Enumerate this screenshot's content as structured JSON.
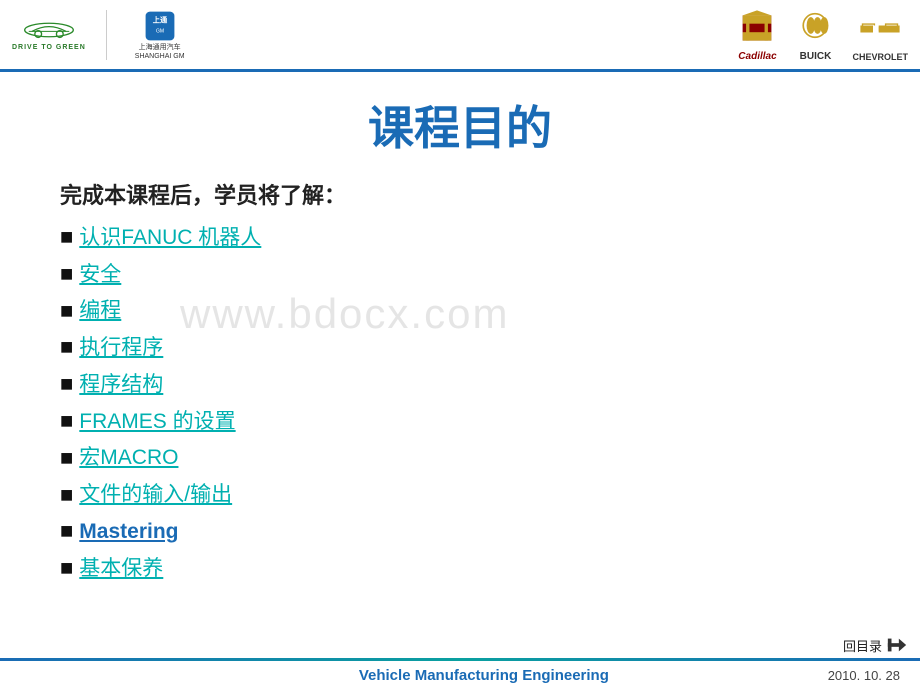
{
  "header": {
    "left_logo_text": "DRIVE TO GREEN",
    "shanghai_gm_line1": "上海通用汽车",
    "shanghai_gm_line2": "SHANGHAI GM",
    "brands": [
      {
        "name": "Cadillac",
        "label": "Cadillac"
      },
      {
        "name": "BUICK",
        "label": "BUICK"
      },
      {
        "name": "CHEVROLET",
        "label": "CHEVROLET"
      }
    ]
  },
  "page": {
    "title": "课程目的",
    "subtitle": "完成本课程后，学员将了解：",
    "menu_items": [
      {
        "text": "认识FANUC 机器人",
        "link": true
      },
      {
        "text": "安全",
        "link": true
      },
      {
        "text": "编程",
        "link": true
      },
      {
        "text": "执行程序",
        "link": true
      },
      {
        "text": "程序结构",
        "link": true
      },
      {
        "text": "FRAMES 的设置",
        "link": true
      },
      {
        "text": "宏MACRO",
        "link": true
      },
      {
        "text": "文件的输入/输出",
        "link": true
      },
      {
        "text": "Mastering",
        "link": true,
        "style": "mastering"
      },
      {
        "text": "基本保养",
        "link": true
      }
    ],
    "watermark": "www.bdocx.com",
    "back_to_menu": "回目录"
  },
  "footer": {
    "center_text": "Vehicle Manufacturing Engineering",
    "date": "2010. 10. 28"
  }
}
